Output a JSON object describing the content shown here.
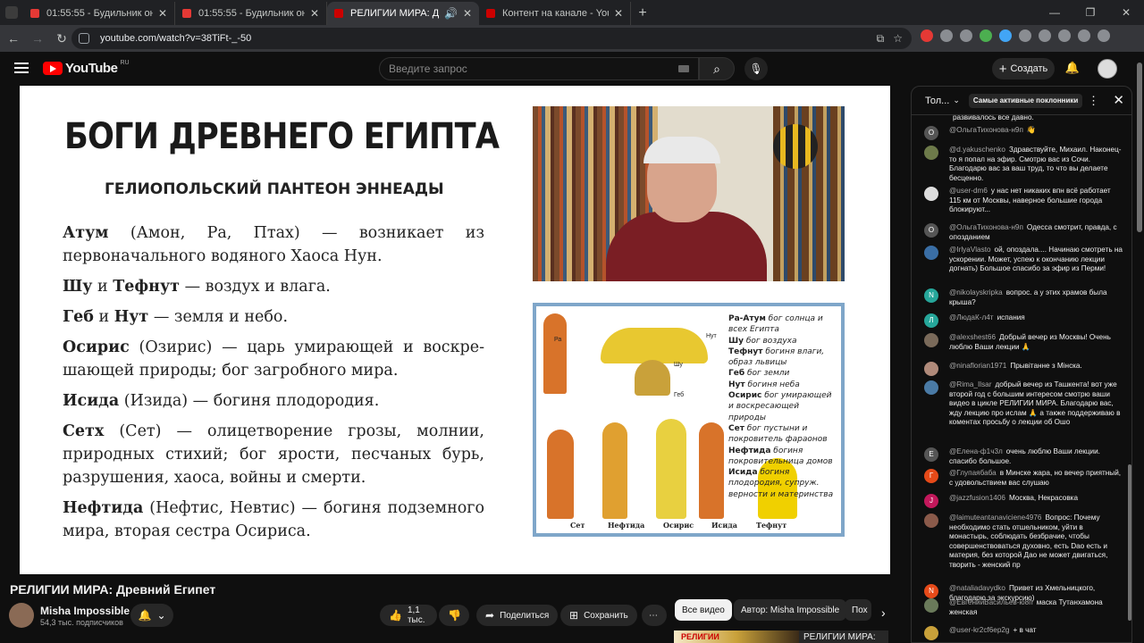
{
  "browser": {
    "tabs": [
      {
        "title": "01:55:55 - Будильник онлайн"
      },
      {
        "title": "01:55:55 - Будильник онлайн"
      },
      {
        "title": "РЕЛИГИИ МИРА: Древний"
      },
      {
        "title": "Контент на канале - YouTube S"
      }
    ],
    "url": "youtube.com/watch?v=38TiFt-_-50"
  },
  "header": {
    "logo": "YouTube",
    "region": "RU",
    "search_placeholder": "Введите запрос",
    "create_label": "Создать"
  },
  "slide": {
    "title": "БОГИ ДРЕВНЕГО ЕГИПТА",
    "subtitle": "ГЕЛИОПОЛЬСКИЙ ПАНТЕОН ЭННЕАДЫ",
    "items": [
      {
        "name": "Атум",
        "rest": " (Амон, Ра, Птах) — возникает из первоначального водяного Хаоса Нун."
      },
      {
        "name": "Шу",
        "mid": " и ",
        "name2": "Тефнут",
        "rest": " — воздух и влага."
      },
      {
        "name": "Геб",
        "mid": " и ",
        "name2": "Нут",
        "rest": " — земля и небо."
      },
      {
        "name": "Осирис",
        "rest": " (Озирис) — царь умирающей и воскре-шающей природы; бог загробного мира."
      },
      {
        "name": "Исида",
        "rest": " (Изида) — богиня плодородия."
      },
      {
        "name": "Сетх",
        "rest": " (Сет) — олицетворение грозы, молнии, природных стихий; бог ярости, песчаных бурь, разрушения, хаоса, войны и смерти."
      },
      {
        "name": "Нефтида",
        "rest": " (Нефтис, Невтис) — богиня подземного мира, вторая сестра Осириса."
      }
    ],
    "illustration": {
      "side_lines": [
        {
          "b": "Ра-Атум",
          "t": " бог солнца и всех Египта"
        },
        {
          "b": "Шу",
          "t": " бог воздуха"
        },
        {
          "b": "Тефнут",
          "t": " богиня влаги, образ львицы"
        },
        {
          "b": "Геб",
          "t": " бог земли"
        },
        {
          "b": "Нут",
          "t": " богиня неба"
        },
        {
          "b": "Осирис",
          "t": " бог умирающей и воскресающей природы"
        },
        {
          "b": "Сет",
          "t": " бог пустыни и покровитель фараонов"
        },
        {
          "b": "Нефтида",
          "t": " богиня покровительница домов"
        },
        {
          "b": "Исида",
          "t": " богиня плодородия, супруж. верности и материнства"
        }
      ],
      "labels_top": [
        "Ра",
        "Нут",
        "Шу",
        "Геб"
      ],
      "captions": [
        "Сет",
        "Нефтида",
        "Осирис",
        "Исида",
        "Тефнут"
      ]
    }
  },
  "video": {
    "title": "РЕЛИГИИ МИРА: Древний Египет",
    "channel": "Misha Impossible",
    "subscribers": "54,3 тыс. подписчиков",
    "likes": "1,1 тыс.",
    "share": "Поделиться",
    "save": "Сохранить"
  },
  "chips": [
    "Все видео",
    "Автор: Misha Impossible",
    "Пох"
  ],
  "next_video": {
    "label": "РЕЛИГИИ",
    "title": "РЕЛИГИИ МИРА:"
  },
  "chat": {
    "mode": "Тол...",
    "badge": "Самые активные поклонники",
    "messages": [
      {
        "author": "",
        "text": "развивалось все давно.",
        "avatar": "",
        "color": "#0f0f0f"
      },
      {
        "author": "@ОльгаТихонова-н9п",
        "text": "👋",
        "avatar": "О",
        "color": "#555"
      },
      {
        "author": "@d.yakuschenko",
        "text": "Здравствуйте, Михаил. Наконец-то я попал на эфир. Смотрю вас из Сочи. Благодарю вас за ваш труд, то что вы делаете бесценно.",
        "avatar": "",
        "color": "#6d7a4a"
      },
      {
        "author": "@user-dm6",
        "text": "у нас нет никаких впн всё работает 115 км от Москвы, наверное большие города блокируют...",
        "avatar": "",
        "color": "#ddd"
      },
      {
        "author": "@ОльгаТихонова-н9п",
        "text": "Одесса смотрит, правда, с опозданием",
        "avatar": "О",
        "color": "#555"
      },
      {
        "author": "@IrlyaVlasto",
        "text": "ой, опоздала.... Начинаю смотреть на ускорении. Может, успею к окончанию лекции догнать) Большое спасибо за эфир из Перми!",
        "avatar": "",
        "color": "#3a6ea5"
      },
      {
        "author": "@nikolayskripka",
        "text": "вопрос. а у этих храмов была крыша?",
        "avatar": "N",
        "color": "#26a69a"
      },
      {
        "author": "@ЛюдаК-л4т",
        "text": "испания",
        "avatar": "Л",
        "color": "#26a69a"
      },
      {
        "author": "@alexshest66",
        "text": "Добрый вечер из Москвы! Очень люблю Ваши лекции 🙏",
        "avatar": "",
        "color": "#7a6a5a"
      },
      {
        "author": "@ninaflorian1971",
        "text": "Прывітанне з Мінска.",
        "avatar": "",
        "color": "#b08a7a"
      },
      {
        "author": "@Rima_Ilsar",
        "text": "добрый вечер из Ташкента! вот уже второй год с большим интересом смотрю ваши видео в цикле РЕЛИГИИ МИРА. Благодарю вас, жду лекцию про ислам 🙏 а также поддерживаю в коментах просьбу о лекции об Ошо",
        "avatar": "",
        "color": "#4a7aa5"
      },
      {
        "author": "@Елена-ф1ч3л",
        "text": "очень люблю Ваши лекции. спасибо большое.",
        "avatar": "Е",
        "color": "#555"
      },
      {
        "author": "@Глупаябаба",
        "text": "в Минске жара, но вечер приятный, с удовольствием вас слушаю",
        "avatar": "Г",
        "color": "#e64a19"
      },
      {
        "author": "@jazzfusion1406",
        "text": "Москва, Некрасовка",
        "avatar": "J",
        "color": "#c2185b"
      },
      {
        "author": "@laimuteantanaviciene4976",
        "text": "Вопрос: Почему необходимо стать отшельником, уйти в монастырь, соблюдать безбрачие, чтобы совершенствоваться духовно, есть Dao есть и материя, без которой Дао не может двигаться, творить - женский пр",
        "avatar": "",
        "color": "#8a5a4a"
      },
      {
        "author": "@nataliadavydko",
        "text": "Привет из Хмельницкого, благодарю за экскурсию)",
        "avatar": "N",
        "color": "#e64a19"
      },
      {
        "author": "@ЕвгенийВасильев-ю8п",
        "text": "маска Тутанхамона женская",
        "avatar": "",
        "color": "#6a7a5a"
      },
      {
        "author": "@user-kr2cf6ep2g",
        "text": "+ в чат",
        "avatar": "",
        "color": "#c9a13a"
      }
    ]
  },
  "colors": {
    "yt_red": "#ff0000",
    "bg": "#0f0f0f",
    "panel": "#272727"
  }
}
